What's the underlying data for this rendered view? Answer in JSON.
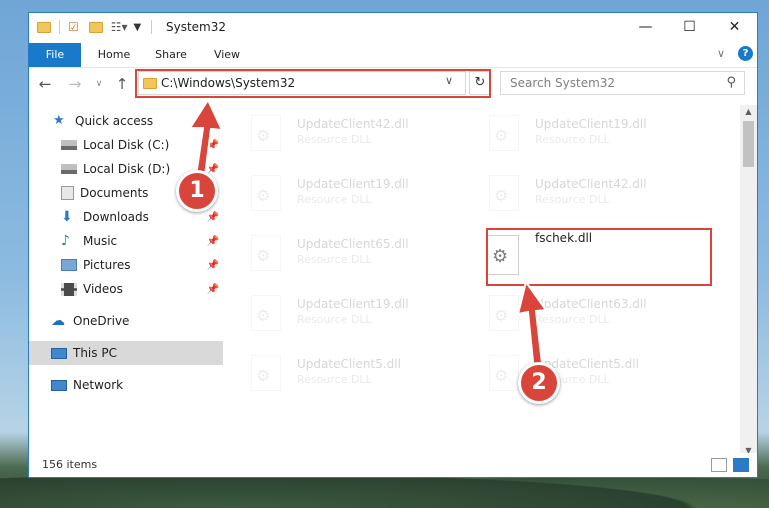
{
  "window": {
    "title": "System32",
    "controls": {
      "minimize": "—",
      "maximize": "☐",
      "close": "✕"
    }
  },
  "ribbon": {
    "tabs": [
      "File",
      "Home",
      "Share",
      "View"
    ]
  },
  "nav": {
    "address": "C:\\Windows\\System32",
    "search_placeholder": "Search System32"
  },
  "sidebar": {
    "items": [
      {
        "label": "Quick access",
        "icon": "star-icon",
        "pinned": false
      },
      {
        "label": "Local Disk (C:)",
        "icon": "drive-icon",
        "pinned": true
      },
      {
        "label": "Local Disk (D:)",
        "icon": "drive-icon",
        "pinned": true
      },
      {
        "label": "Documents",
        "icon": "documents-icon",
        "pinned": true
      },
      {
        "label": "Downloads",
        "icon": "download-icon",
        "pinned": true
      },
      {
        "label": "Music",
        "icon": "music-icon",
        "pinned": true
      },
      {
        "label": "Pictures",
        "icon": "pictures-icon",
        "pinned": true
      },
      {
        "label": "Videos",
        "icon": "videos-icon",
        "pinned": true
      },
      {
        "label": "OneDrive",
        "icon": "cloud-icon",
        "pinned": false
      },
      {
        "label": "This PC",
        "icon": "computer-icon",
        "pinned": false,
        "selected": true
      },
      {
        "label": "Network",
        "icon": "network-icon",
        "pinned": false
      }
    ]
  },
  "files": [
    {
      "name": "UpdateClient42.dll",
      "type": "Resource DLL"
    },
    {
      "name": "UpdateClient19.dll",
      "type": "Resource DLL"
    },
    {
      "name": "UpdateClient19.dll",
      "type": "Resource DLL"
    },
    {
      "name": "UpdateClient42.dll",
      "type": "Resource DLL"
    },
    {
      "name": "UpdateClient65.dll",
      "type": "Resource DLL"
    },
    {
      "name": "fschek.dll",
      "type": ""
    },
    {
      "name": "UpdateClient19.dll",
      "type": "Resource DLL"
    },
    {
      "name": "UpdateClient63.dll",
      "type": "Resource DLL"
    },
    {
      "name": "UpdateClient5.dll",
      "type": "Resource DLL"
    },
    {
      "name": "UpdateClient5.dll",
      "type": "Resource DLL"
    }
  ],
  "status": {
    "item_count": "156 items"
  },
  "annotations": {
    "step1": "1",
    "step2": "2"
  },
  "colors": {
    "accent": "#1979ca",
    "annotation_red": "#d9443b"
  }
}
